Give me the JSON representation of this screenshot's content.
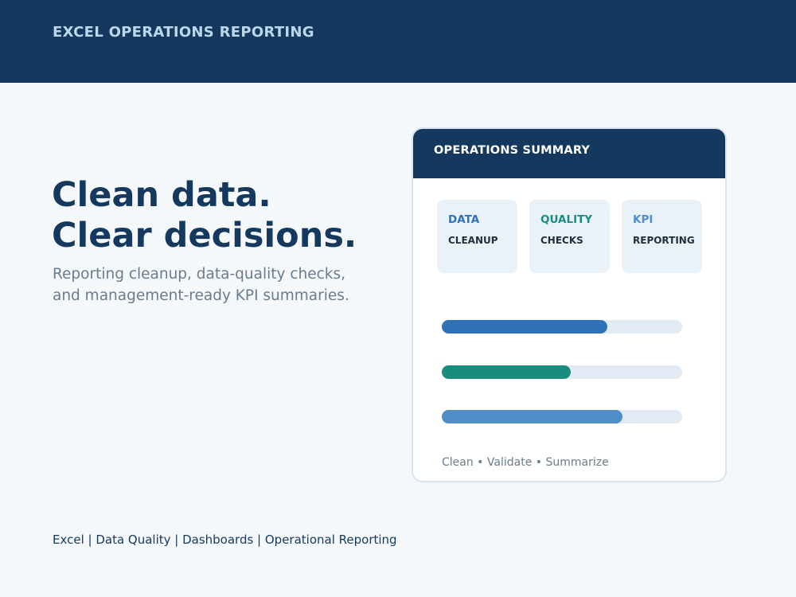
{
  "header": {
    "brand": "EXCEL OPERATIONS REPORTING"
  },
  "hero": {
    "title_line1": "Clean data.",
    "title_line2": "Clear decisions.",
    "subtitle_line1": "Reporting cleanup, data-quality checks,",
    "subtitle_line2": "and management-ready KPI summaries."
  },
  "summary_card": {
    "title": "OPERATIONS SUMMARY",
    "tiles": [
      {
        "kicker": "DATA",
        "label": "CLEANUP",
        "color": "#2f72b8"
      },
      {
        "kicker": "QUALITY",
        "label": "CHECKS",
        "color": "#198c80"
      },
      {
        "kicker": "KPI",
        "label": "REPORTING",
        "color": "#4f8ec9"
      }
    ],
    "bars": [
      {
        "fraction": 0.69,
        "color": "#2f72b8"
      },
      {
        "fraction": 0.535,
        "color": "#198c80"
      },
      {
        "fraction": 0.75,
        "color": "#4f8ec9"
      }
    ],
    "footer": "Clean  •  Validate  •  Summarize"
  },
  "tags_line": "Excel  |  Data Quality  |  Dashboards  |  Operational Reporting"
}
